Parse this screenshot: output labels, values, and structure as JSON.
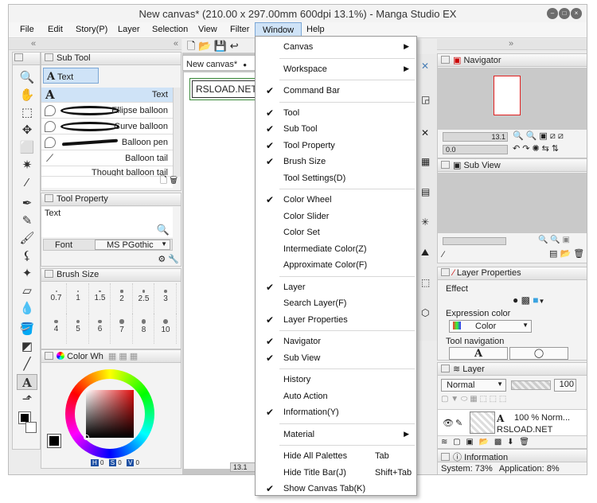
{
  "title": "New canvas* (210.00 x 297.00mm 600dpi 13.1%)  - Manga Studio EX",
  "menubar": [
    "File",
    "Edit",
    "Story(P)",
    "Layer",
    "Selection",
    "View",
    "Filter",
    "Window",
    "Help"
  ],
  "canvas_tab": "New canvas*",
  "balloon_text": "RSLOAD.NET",
  "subtool": {
    "title": "Sub Tool",
    "group": "Text",
    "items": [
      "Text",
      "Ellipse balloon",
      "Curve balloon",
      "Balloon pen",
      "Balloon tail",
      "Thought balloon tail"
    ]
  },
  "toolprop": {
    "title": "Tool Property",
    "name": "Text",
    "font_label": "Font",
    "font_value": "MS PGothic"
  },
  "brushsize": {
    "title": "Brush Size",
    "row1": [
      "0.7",
      "1",
      "1.5",
      "2",
      "2.5",
      "3"
    ],
    "row2": [
      "4",
      "5",
      "6",
      "7",
      "8",
      "10"
    ]
  },
  "colorwheel": {
    "title": "Color Wh",
    "h": "0",
    "s": "0",
    "v": "0"
  },
  "zoom_value": "13.1",
  "navigator": {
    "title": "Navigator",
    "zoom": "13.1",
    "angle": "0.0"
  },
  "subview": {
    "title": "Sub View"
  },
  "layerprops": {
    "title": "Layer Properties",
    "effect": "Effect",
    "expr_label": "Expression color",
    "expr_value": "Color",
    "nav_label": "Tool navigation"
  },
  "layer": {
    "title": "Layer",
    "blend": "Normal",
    "opacity": "100",
    "row_pct": "100 %",
    "row_mode": "Norm...",
    "row_name": "RSLOAD.NET"
  },
  "info": {
    "title": "Information",
    "system": "System: 73%",
    "application": "Application:  8%"
  },
  "window_menu": [
    {
      "label": "Canvas",
      "check": false,
      "shortcut": "",
      "sub": true
    },
    {
      "sep": true
    },
    {
      "label": "Workspace",
      "check": false,
      "shortcut": "",
      "sub": true
    },
    {
      "sep": true
    },
    {
      "label": "Command Bar",
      "check": true,
      "shortcut": "",
      "sub": false
    },
    {
      "sep": true
    },
    {
      "label": "Tool",
      "check": true,
      "shortcut": "",
      "sub": false
    },
    {
      "label": "Sub Tool",
      "check": true,
      "shortcut": "",
      "sub": false
    },
    {
      "label": "Tool Property",
      "check": true,
      "shortcut": "",
      "sub": false
    },
    {
      "label": "Brush Size",
      "check": true,
      "shortcut": "",
      "sub": false
    },
    {
      "label": "Tool Settings(D)",
      "check": false,
      "shortcut": "",
      "sub": false
    },
    {
      "sep": true
    },
    {
      "label": "Color Wheel",
      "check": true,
      "shortcut": "",
      "sub": false
    },
    {
      "label": "Color Slider",
      "check": false,
      "shortcut": "",
      "sub": false
    },
    {
      "label": "Color Set",
      "check": false,
      "shortcut": "",
      "sub": false
    },
    {
      "label": "Intermediate Color(Z)",
      "check": false,
      "shortcut": "",
      "sub": false
    },
    {
      "label": "Approximate Color(F)",
      "check": false,
      "shortcut": "",
      "sub": false
    },
    {
      "sep": true
    },
    {
      "label": "Layer",
      "check": true,
      "shortcut": "",
      "sub": false
    },
    {
      "label": "Search Layer(F)",
      "check": false,
      "shortcut": "",
      "sub": false
    },
    {
      "label": "Layer Properties",
      "check": true,
      "shortcut": "",
      "sub": false
    },
    {
      "sep": true
    },
    {
      "label": "Navigator",
      "check": true,
      "shortcut": "",
      "sub": false
    },
    {
      "label": "Sub View",
      "check": true,
      "shortcut": "",
      "sub": false
    },
    {
      "sep": true
    },
    {
      "label": "History",
      "check": false,
      "shortcut": "",
      "sub": false
    },
    {
      "label": "Auto Action",
      "check": false,
      "shortcut": "",
      "sub": false
    },
    {
      "label": "Information(Y)",
      "check": true,
      "shortcut": "",
      "sub": false
    },
    {
      "sep": true
    },
    {
      "label": "Material",
      "check": false,
      "shortcut": "",
      "sub": true
    },
    {
      "sep": true
    },
    {
      "label": "Hide All Palettes",
      "check": false,
      "shortcut": "Tab",
      "sub": false
    },
    {
      "label": "Hide Title Bar(J)",
      "check": false,
      "shortcut": "Shift+Tab",
      "sub": false
    },
    {
      "label": "Show Canvas Tab(K)",
      "check": true,
      "shortcut": "",
      "sub": false
    }
  ],
  "colors": {
    "accent": "#cfe3f7",
    "accent_border": "#7ba7d6",
    "panel": "#f3f3f3",
    "nav_rect": "#e02020"
  }
}
